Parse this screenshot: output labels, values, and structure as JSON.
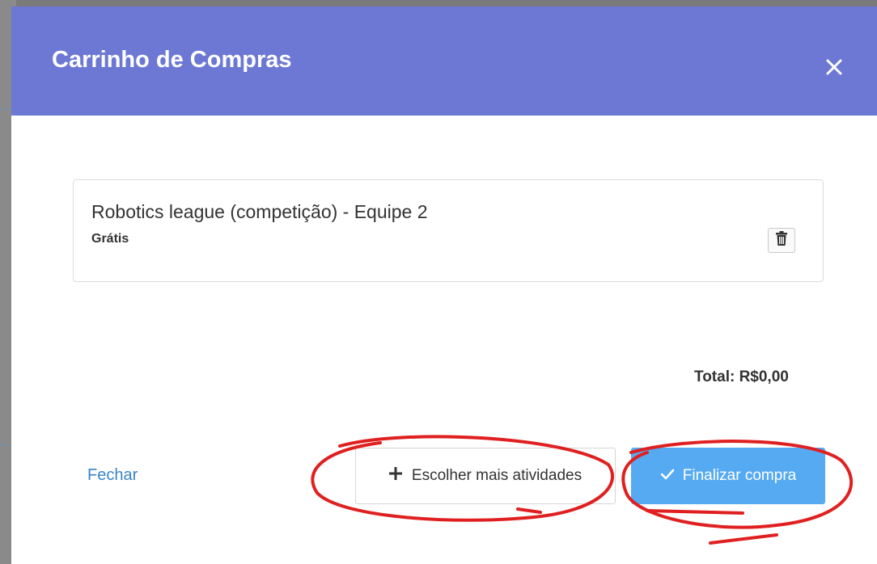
{
  "modal": {
    "title": "Carrinho de Compras",
    "close_icon": "close-icon"
  },
  "cart": {
    "items": [
      {
        "name": "Robotics league (competição) - Equipe 2",
        "price": "Grátis",
        "delete_icon": "trash-icon"
      }
    ],
    "total": "Total: R$0,00"
  },
  "footer": {
    "close_label": "Fechar",
    "more_label": "Escolher mais atividades",
    "more_icon": "plus-icon",
    "finish_label": "Finalizar compra",
    "finish_icon": "check-icon"
  },
  "colors": {
    "header": "#6c78d4",
    "primary_button": "#56aaf2",
    "link": "#3a84c6",
    "annotation": "#e02020"
  }
}
